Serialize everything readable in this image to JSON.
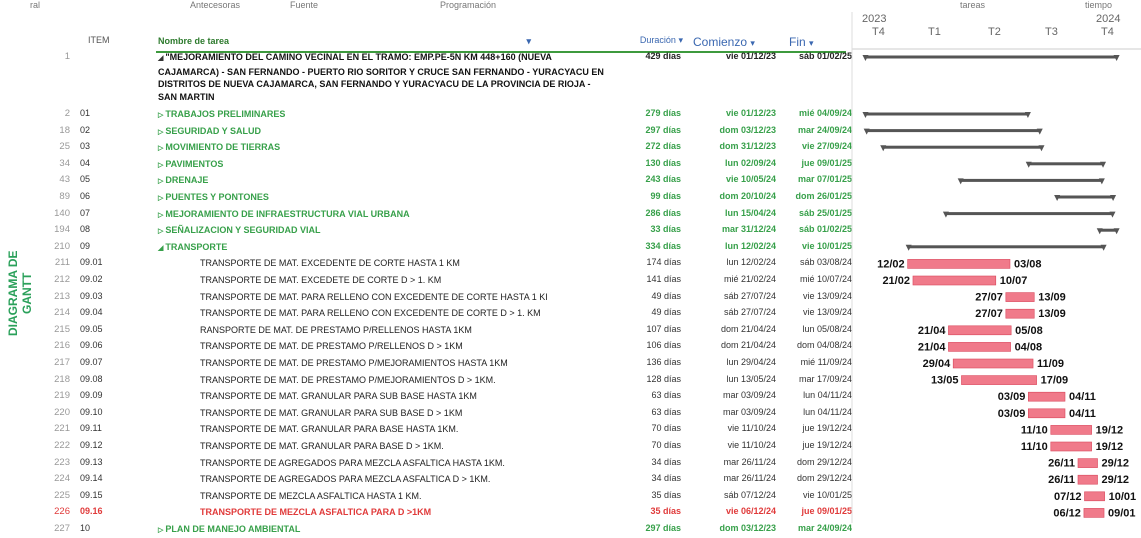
{
  "top_strip": [
    "ral",
    "Antecesoras",
    "Fuente",
    "Programación",
    "tareas",
    "tiempo"
  ],
  "headers": {
    "item": "ITEM",
    "name": "Nombre de tarea",
    "duration": "Duración",
    "start": "Comienzo",
    "end": "Fin"
  },
  "timeline": {
    "year_2023": "2023",
    "year_2024": "2024",
    "q1": "T4",
    "q2": "T1",
    "q3": "T2",
    "q4": "T3",
    "q5": "T4"
  },
  "side_label": "DIAGRAMA DE GANTT",
  "rows": [
    {
      "num": "1",
      "item": "",
      "name": "\"MEJORAMIENTO DEL CAMINO VECINAL EN EL TRAMO: EMP.PE-5N KM 448+160 (NUEVA CAJAMARCA) - SAN FERNANDO - PUERTO RIO SORITOR Y CRUCE SAN FERNANDO - YURACYACU EN DISTRITOS DE NUEVA CAJAMARCA, SAN FERNANDO Y YURACYACU DE LA PROVINCIA DE RIOJA - SAN MARTIN",
      "duration": "429 días",
      "start": "vie 01/12/23",
      "end": "sáb 01/02/25"
    },
    {
      "num": "2",
      "item": "01",
      "name": "TRABAJOS PRELIMINARES",
      "duration": "279 días",
      "start": "vie 01/12/23",
      "end": "mié 04/09/24"
    },
    {
      "num": "18",
      "item": "02",
      "name": "SEGURIDAD Y SALUD",
      "duration": "297 días",
      "start": "dom 03/12/23",
      "end": "mar 24/09/24"
    },
    {
      "num": "25",
      "item": "03",
      "name": "MOVIMIENTO DE TIERRAS",
      "duration": "272 días",
      "start": "dom 31/12/23",
      "end": "vie 27/09/24"
    },
    {
      "num": "34",
      "item": "04",
      "name": "PAVIMENTOS",
      "duration": "130 días",
      "start": "lun 02/09/24",
      "end": "jue 09/01/25"
    },
    {
      "num": "43",
      "item": "05",
      "name": "DRENAJE",
      "duration": "243 días",
      "start": "vie 10/05/24",
      "end": "mar 07/01/25"
    },
    {
      "num": "89",
      "item": "06",
      "name": "PUENTES Y PONTONES",
      "duration": "99 días",
      "start": "dom 20/10/24",
      "end": "dom 26/01/25"
    },
    {
      "num": "140",
      "item": "07",
      "name": "MEJORAMIENTO DE INFRAESTRUCTURA VIAL URBANA",
      "duration": "286 días",
      "start": "lun 15/04/24",
      "end": "sáb 25/01/25"
    },
    {
      "num": "194",
      "item": "08",
      "name": "SEÑALIZACION Y SEGURIDAD VIAL",
      "duration": "33 días",
      "start": "mar 31/12/24",
      "end": "sáb 01/02/25"
    },
    {
      "num": "210",
      "item": "09",
      "name": "TRANSPORTE",
      "duration": "334 días",
      "start": "lun 12/02/24",
      "end": "vie 10/01/25"
    },
    {
      "num": "211",
      "item": "09.01",
      "name": "TRANSPORTE DE MAT. EXCEDENTE DE CORTE HASTA 1 KM",
      "duration": "174 días",
      "start": "lun 12/02/24",
      "end": "sáb 03/08/24",
      "bar_start": "12/02",
      "bar_end": "03/08"
    },
    {
      "num": "212",
      "item": "09.02",
      "name": "TRANSPORTE DE MAT. EXCEDETE DE CORTE D > 1. KM",
      "duration": "141 días",
      "start": "mié 21/02/24",
      "end": "mié 10/07/24",
      "bar_start": "21/02",
      "bar_end": "10/07"
    },
    {
      "num": "213",
      "item": "09.03",
      "name": "TRANSPORTE DE MAT. PARA RELLENO CON EXCEDENTE DE CORTE HASTA 1 KI",
      "duration": "49 días",
      "start": "sáb 27/07/24",
      "end": "vie 13/09/24",
      "bar_start": "27/07",
      "bar_end": "13/09"
    },
    {
      "num": "214",
      "item": "09.04",
      "name": "TRANSPORTE DE MAT. PARA RELLENO CON EXCEDENTE DE CORTE D > 1. KM",
      "duration": "49 días",
      "start": "sáb 27/07/24",
      "end": "vie 13/09/24",
      "bar_start": "27/07",
      "bar_end": "13/09"
    },
    {
      "num": "215",
      "item": "09.05",
      "name": "RANSPORTE DE MAT. DE PRESTAMO P/RELLENOS HASTA 1KM",
      "duration": "107 días",
      "start": "dom 21/04/24",
      "end": "lun 05/08/24",
      "bar_start": "21/04",
      "bar_end": "05/08"
    },
    {
      "num": "216",
      "item": "09.06",
      "name": "TRANSPORTE DE MAT. DE PRESTAMO P/RELLENOS D > 1KM",
      "duration": "106 días",
      "start": "dom 21/04/24",
      "end": "dom 04/08/24",
      "bar_start": "21/04",
      "bar_end": "04/08"
    },
    {
      "num": "217",
      "item": "09.07",
      "name": "TRANSPORTE DE MAT. DE PRESTAMO P/MEJORAMIENTOS HASTA 1KM",
      "duration": "136 días",
      "start": "lun 29/04/24",
      "end": "mié 11/09/24",
      "bar_start": "29/04",
      "bar_end": "11/09"
    },
    {
      "num": "218",
      "item": "09.08",
      "name": "TRANSPORTE DE MAT. DE PRESTAMO P/MEJORAMIENTOS D > 1KM.",
      "duration": "128 días",
      "start": "lun 13/05/24",
      "end": "mar 17/09/24",
      "bar_start": "13/05",
      "bar_end": "17/09"
    },
    {
      "num": "219",
      "item": "09.09",
      "name": "TRANSPORTE DE MAT. GRANULAR PARA SUB BASE HASTA 1KM",
      "duration": "63 días",
      "start": "mar 03/09/24",
      "end": "lun 04/11/24",
      "bar_start": "03/09",
      "bar_end": "04/11"
    },
    {
      "num": "220",
      "item": "09.10",
      "name": "TRANSPORTE DE MAT. GRANULAR PARA SUB BASE D > 1KM",
      "duration": "63 días",
      "start": "mar 03/09/24",
      "end": "lun 04/11/24",
      "bar_start": "03/09",
      "bar_end": "04/11"
    },
    {
      "num": "221",
      "item": "09.11",
      "name": "TRANSPORTE DE MAT. GRANULAR PARA BASE HASTA 1KM.",
      "duration": "70 días",
      "start": "vie 11/10/24",
      "end": "jue 19/12/24",
      "bar_start": "11/10",
      "bar_end": "19/12"
    },
    {
      "num": "222",
      "item": "09.12",
      "name": "TRANSPORTE DE MAT. GRANULAR PARA BASE D > 1KM.",
      "duration": "70 días",
      "start": "vie 11/10/24",
      "end": "jue 19/12/24",
      "bar_start": "11/10",
      "bar_end": "19/12"
    },
    {
      "num": "223",
      "item": "09.13",
      "name": "TRANSPORTE DE AGREGADOS PARA MEZCLA ASFALTICA HASTA 1KM.",
      "duration": "34 días",
      "start": "mar 26/11/24",
      "end": "dom 29/12/24",
      "bar_start": "26/11",
      "bar_end": "29/12"
    },
    {
      "num": "224",
      "item": "09.14",
      "name": "TRANSPORTE DE AGREGADOS PARA MEZCLA ASFALTICA D > 1KM.",
      "duration": "34 días",
      "start": "mar 26/11/24",
      "end": "dom 29/12/24",
      "bar_start": "26/11",
      "bar_end": "29/12"
    },
    {
      "num": "225",
      "item": "09.15",
      "name": "TRANSPORTE DE MEZCLA ASFALTICA HASTA 1 KM.",
      "duration": "35 días",
      "start": "sáb 07/12/24",
      "end": "vie 10/01/25",
      "bar_start": "07/12",
      "bar_end": "10/01"
    },
    {
      "num": "226",
      "item": "09.16",
      "name": "TRANSPORTE DE MEZCLA ASFALTICA PARA D >1KM",
      "duration": "35 días",
      "start": "vie 06/12/24",
      "end": "jue 09/01/25",
      "bar_start": "06/12",
      "bar_end": "09/01"
    },
    {
      "num": "227",
      "item": "10",
      "name": "PLAN DE MANEJO AMBIENTAL",
      "duration": "297 días",
      "start": "dom 03/12/23",
      "end": "mar 24/09/24"
    }
  ],
  "colors": {
    "summary_green": "#37a04a",
    "header_green": "#2d7a2d",
    "critical_red": "#e03a3a",
    "bar_pink": "#f07a8a",
    "summary_bar": "#555555",
    "column_blue": "#3a67b0"
  }
}
